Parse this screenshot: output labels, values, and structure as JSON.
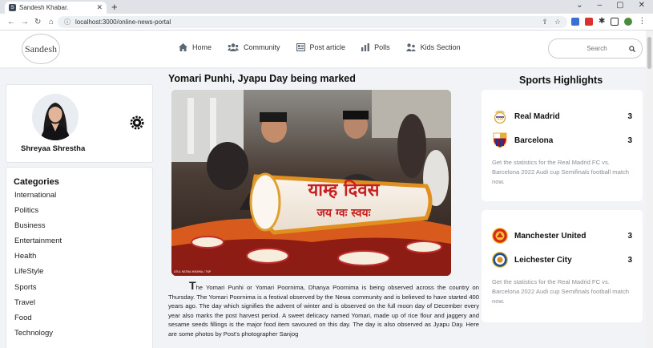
{
  "browser": {
    "tab_title": "Sandesh Khabar.",
    "url": "localhost:3000/online-news-portal"
  },
  "site": {
    "logo_text": "Sandesh",
    "nav": [
      {
        "label": "Home",
        "icon": "home-icon"
      },
      {
        "label": "Community",
        "icon": "users-icon"
      },
      {
        "label": "Post article",
        "icon": "newspaper-icon"
      },
      {
        "label": "Polls",
        "icon": "bar-chart-icon"
      },
      {
        "label": "Kids Section",
        "icon": "kids-icon"
      }
    ],
    "search_placeholder": "Search"
  },
  "profile": {
    "name": "Shreyaa Shrestha"
  },
  "categories": {
    "title": "Categories",
    "items": [
      "International",
      "Politics",
      "Business",
      "Entertainment",
      "Health",
      "LifeStyle",
      "Sports",
      "Travel",
      "Food",
      "Technology"
    ]
  },
  "article": {
    "title": "Yomari Punhi, Jyapu Day being marked",
    "image_text_line1": "याम्ह दिवस",
    "image_text_line2": "जय ग्वः स्वयः",
    "image_credit": "ATUL RATNA MISHRA / TKP",
    "dropcap": "T",
    "body": "he Yomari Punhi or Yomari Poornima, Dhanya Poornima is being observed across the country on Thursday. The Yomari Poornima is a festival observed by the Newa community and is believed to have started 400 years ago. The day which signifies the advent of winter and is observed on the full moon day of December every year also marks the post harvest period. A sweet delicacy named Yomari, made up of rice flour and jaggery and sesame seeds fillings is the major food item savoured on this day. The day is also observed as Jyapu Day. Here are some photos by Post's photographer Sanjog"
  },
  "sports": {
    "title": "Sports Highlights",
    "matches": [
      {
        "teams": [
          {
            "name": "Real Madrid",
            "score": "3",
            "logo": "real-madrid-logo"
          },
          {
            "name": "Barcelona",
            "score": "3",
            "logo": "barcelona-logo"
          }
        ],
        "description": "Get the statistics for the Real Madrid FC vs. Barcelona 2022 Audi cup Semifinals football match now."
      },
      {
        "teams": [
          {
            "name": "Manchester United",
            "score": "3",
            "logo": "manchester-united-logo"
          },
          {
            "name": "Leichester City",
            "score": "3",
            "logo": "leicester-city-logo"
          }
        ],
        "description": "Get the statistics for the Real Madrid FC vs. Barcelona 2022 Audi cup Semifinals football match now."
      }
    ]
  },
  "colors": {
    "page_bg": "#f1f3f6",
    "card_bg": "#ffffff",
    "muted_text": "#8a8f96"
  }
}
